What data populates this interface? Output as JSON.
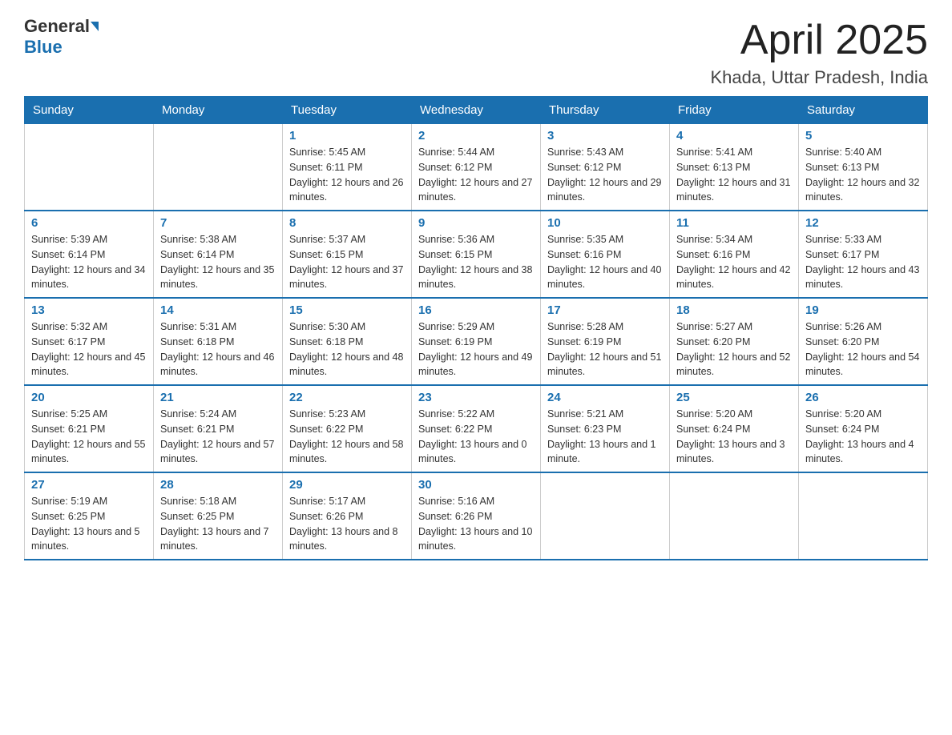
{
  "logo": {
    "general": "General",
    "blue": "Blue"
  },
  "title": "April 2025",
  "subtitle": "Khada, Uttar Pradesh, India",
  "days_of_week": [
    "Sunday",
    "Monday",
    "Tuesday",
    "Wednesday",
    "Thursday",
    "Friday",
    "Saturday"
  ],
  "weeks": [
    [
      {
        "day": "",
        "data": ""
      },
      {
        "day": "",
        "data": ""
      },
      {
        "day": "1",
        "sunrise": "5:45 AM",
        "sunset": "6:11 PM",
        "daylight": "12 hours and 26 minutes."
      },
      {
        "day": "2",
        "sunrise": "5:44 AM",
        "sunset": "6:12 PM",
        "daylight": "12 hours and 27 minutes."
      },
      {
        "day": "3",
        "sunrise": "5:43 AM",
        "sunset": "6:12 PM",
        "daylight": "12 hours and 29 minutes."
      },
      {
        "day": "4",
        "sunrise": "5:41 AM",
        "sunset": "6:13 PM",
        "daylight": "12 hours and 31 minutes."
      },
      {
        "day": "5",
        "sunrise": "5:40 AM",
        "sunset": "6:13 PM",
        "daylight": "12 hours and 32 minutes."
      }
    ],
    [
      {
        "day": "6",
        "sunrise": "5:39 AM",
        "sunset": "6:14 PM",
        "daylight": "12 hours and 34 minutes."
      },
      {
        "day": "7",
        "sunrise": "5:38 AM",
        "sunset": "6:14 PM",
        "daylight": "12 hours and 35 minutes."
      },
      {
        "day": "8",
        "sunrise": "5:37 AM",
        "sunset": "6:15 PM",
        "daylight": "12 hours and 37 minutes."
      },
      {
        "day": "9",
        "sunrise": "5:36 AM",
        "sunset": "6:15 PM",
        "daylight": "12 hours and 38 minutes."
      },
      {
        "day": "10",
        "sunrise": "5:35 AM",
        "sunset": "6:16 PM",
        "daylight": "12 hours and 40 minutes."
      },
      {
        "day": "11",
        "sunrise": "5:34 AM",
        "sunset": "6:16 PM",
        "daylight": "12 hours and 42 minutes."
      },
      {
        "day": "12",
        "sunrise": "5:33 AM",
        "sunset": "6:17 PM",
        "daylight": "12 hours and 43 minutes."
      }
    ],
    [
      {
        "day": "13",
        "sunrise": "5:32 AM",
        "sunset": "6:17 PM",
        "daylight": "12 hours and 45 minutes."
      },
      {
        "day": "14",
        "sunrise": "5:31 AM",
        "sunset": "6:18 PM",
        "daylight": "12 hours and 46 minutes."
      },
      {
        "day": "15",
        "sunrise": "5:30 AM",
        "sunset": "6:18 PM",
        "daylight": "12 hours and 48 minutes."
      },
      {
        "day": "16",
        "sunrise": "5:29 AM",
        "sunset": "6:19 PM",
        "daylight": "12 hours and 49 minutes."
      },
      {
        "day": "17",
        "sunrise": "5:28 AM",
        "sunset": "6:19 PM",
        "daylight": "12 hours and 51 minutes."
      },
      {
        "day": "18",
        "sunrise": "5:27 AM",
        "sunset": "6:20 PM",
        "daylight": "12 hours and 52 minutes."
      },
      {
        "day": "19",
        "sunrise": "5:26 AM",
        "sunset": "6:20 PM",
        "daylight": "12 hours and 54 minutes."
      }
    ],
    [
      {
        "day": "20",
        "sunrise": "5:25 AM",
        "sunset": "6:21 PM",
        "daylight": "12 hours and 55 minutes."
      },
      {
        "day": "21",
        "sunrise": "5:24 AM",
        "sunset": "6:21 PM",
        "daylight": "12 hours and 57 minutes."
      },
      {
        "day": "22",
        "sunrise": "5:23 AM",
        "sunset": "6:22 PM",
        "daylight": "12 hours and 58 minutes."
      },
      {
        "day": "23",
        "sunrise": "5:22 AM",
        "sunset": "6:22 PM",
        "daylight": "13 hours and 0 minutes."
      },
      {
        "day": "24",
        "sunrise": "5:21 AM",
        "sunset": "6:23 PM",
        "daylight": "13 hours and 1 minute."
      },
      {
        "day": "25",
        "sunrise": "5:20 AM",
        "sunset": "6:24 PM",
        "daylight": "13 hours and 3 minutes."
      },
      {
        "day": "26",
        "sunrise": "5:20 AM",
        "sunset": "6:24 PM",
        "daylight": "13 hours and 4 minutes."
      }
    ],
    [
      {
        "day": "27",
        "sunrise": "5:19 AM",
        "sunset": "6:25 PM",
        "daylight": "13 hours and 5 minutes."
      },
      {
        "day": "28",
        "sunrise": "5:18 AM",
        "sunset": "6:25 PM",
        "daylight": "13 hours and 7 minutes."
      },
      {
        "day": "29",
        "sunrise": "5:17 AM",
        "sunset": "6:26 PM",
        "daylight": "13 hours and 8 minutes."
      },
      {
        "day": "30",
        "sunrise": "5:16 AM",
        "sunset": "6:26 PM",
        "daylight": "13 hours and 10 minutes."
      },
      {
        "day": "",
        "data": ""
      },
      {
        "day": "",
        "data": ""
      },
      {
        "day": "",
        "data": ""
      }
    ]
  ],
  "labels": {
    "sunrise": "Sunrise:",
    "sunset": "Sunset:",
    "daylight": "Daylight:"
  }
}
